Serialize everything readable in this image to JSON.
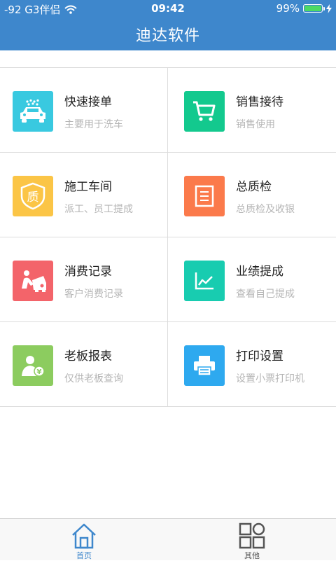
{
  "status_bar": {
    "carrier": "-92 G3伴侣",
    "time": "09:42",
    "battery": "99%",
    "battery_level": 0.99,
    "icons": [
      "wifi-icon",
      "battery-icon",
      "charging-icon"
    ]
  },
  "header": {
    "title": "迪达软件"
  },
  "menu": [
    {
      "label": "快速接单",
      "sub": "主要用于洗车",
      "icon": "car-wash-icon",
      "color": "#39c9e0"
    },
    {
      "label": "销售接待",
      "sub": "销售使用",
      "icon": "shopping-cart-icon",
      "color": "#13c98e"
    },
    {
      "label": "施工车间",
      "sub": "派工、员工提成",
      "icon": "quality-badge-icon",
      "color": "#fbc546"
    },
    {
      "label": "总质检",
      "sub": "总质检及收银",
      "icon": "document-icon",
      "color": "#fb7a4b"
    },
    {
      "label": "消费记录",
      "sub": "客户消费记录",
      "icon": "car-repair-icon",
      "color": "#f3646a"
    },
    {
      "label": "业绩提成",
      "sub": "查看自己提成",
      "icon": "line-chart-icon",
      "color": "#18ccb0"
    },
    {
      "label": "老板报表",
      "sub": "仅供老板查询",
      "icon": "boss-money-icon",
      "color": "#8ccc5f"
    },
    {
      "label": "打印设置",
      "sub": "设置小票打印机",
      "icon": "printer-icon",
      "color": "#2ea9ef"
    }
  ],
  "tabs": [
    {
      "label": "首页",
      "icon": "home-icon",
      "active": true
    },
    {
      "label": "其他",
      "icon": "apps-grid-icon",
      "active": false
    }
  ],
  "colors": {
    "header_bg": "#3e87cc",
    "active_tab": "#3e87cc",
    "inactive_tab": "#555555",
    "battery_fill": "#4cd964"
  }
}
